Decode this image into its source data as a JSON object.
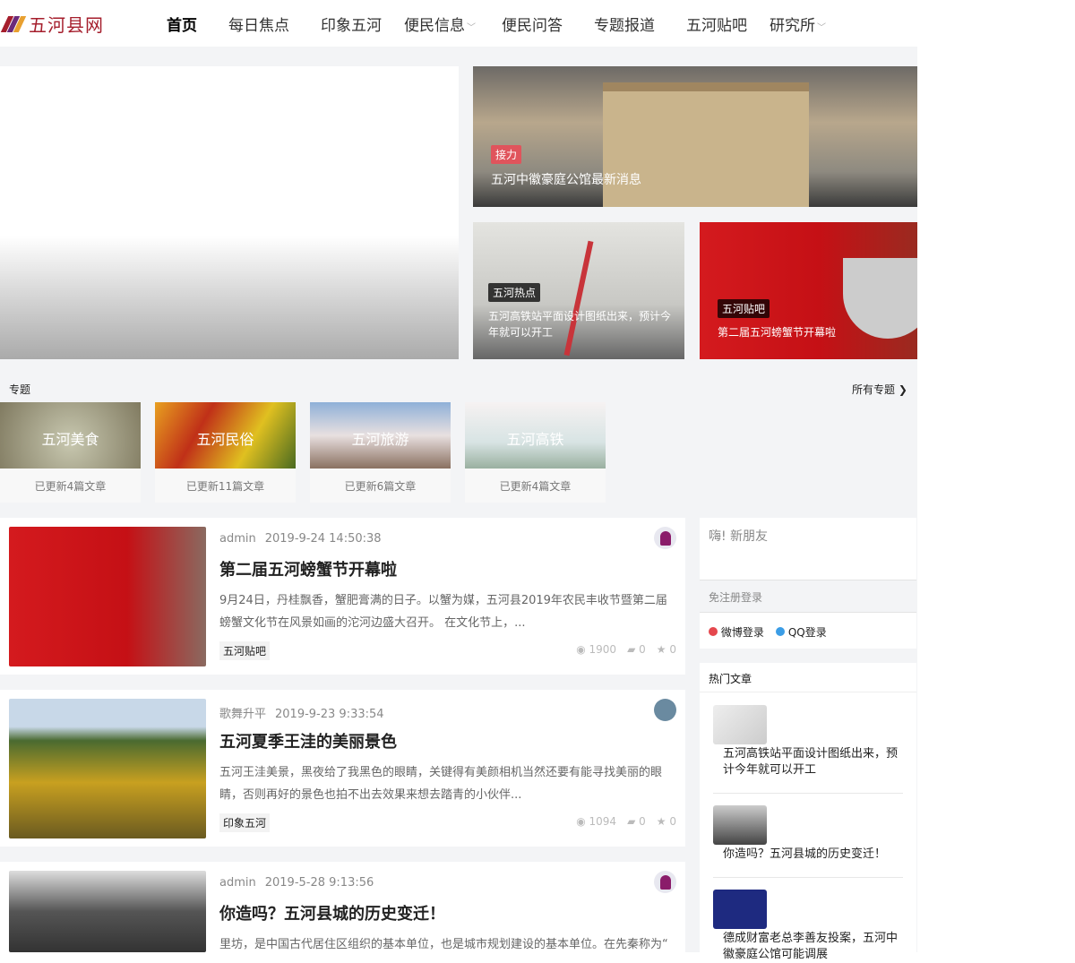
{
  "site": {
    "logo_text": "五河县网"
  },
  "nav": {
    "items": [
      {
        "label": "首页",
        "active": true
      },
      {
        "label": "每日焦点"
      },
      {
        "label": "印象五河"
      },
      {
        "label": "便民信息",
        "dropdown": true
      },
      {
        "label": "便民问答"
      },
      {
        "label": "专题报道"
      },
      {
        "label": "五河贴吧"
      },
      {
        "label": "研究所",
        "dropdown": true
      }
    ]
  },
  "hero": {
    "top": {
      "tag": "接力",
      "title": "五河中徽豪庭公馆最新消息"
    },
    "bottom_left": {
      "tag": "五河热点",
      "title": "五河高铁站平面设计图纸出来，预计今年就可以开工"
    },
    "bottom_right": {
      "tag": "五河贴吧",
      "title": "第二届五河螃蟹节开幕啦"
    }
  },
  "topics": {
    "heading": "专题",
    "all_label": "所有专题 ❯",
    "items": [
      {
        "name": "五河美食",
        "updated": "已更新4篇文章"
      },
      {
        "name": "五河民俗",
        "updated": "已更新11篇文章"
      },
      {
        "name": "五河旅游",
        "updated": "已更新6篇文章"
      },
      {
        "name": "五河高铁",
        "updated": "已更新4篇文章"
      }
    ]
  },
  "articles": [
    {
      "author": "admin",
      "date": "2019-9-24 14:50:38",
      "title": "第二届五河螃蟹节开幕啦",
      "excerpt": "9月24日，丹桂飘香，蟹肥膏满的日子。以蟹为媒，五河县2019年农民丰收节暨第二届螃蟹文化节在风景如画的沱河边盛大召开。 在文化节上，...",
      "category": "五河贴吧",
      "views": "1900",
      "comments": "0",
      "likes": "0"
    },
    {
      "author": "歌舞升平",
      "date": "2019-9-23 9:33:54",
      "title": "五河夏季王洼的美丽景色",
      "excerpt": "五河王洼美景，黑夜给了我黑色的眼睛，关键得有美颜相机当然还要有能寻找美丽的眼睛，否则再好的景色也拍不出去效果来想去踏青的小伙伴...",
      "category": "印象五河",
      "views": "1094",
      "comments": "0",
      "likes": "0"
    },
    {
      "author": "admin",
      "date": "2019-5-28 9:13:56",
      "title": "你造吗？五河县城的历史变迁！",
      "excerpt": "里坊，是中国古代居住区组织的基本单位，也是城市规划建设的基本单位。在先秦称为“"
    }
  ],
  "sidebar": {
    "greeting": "嗨! 新朋友",
    "login_heading": "免注册登录",
    "weibo_login": "微博登录",
    "qq_login": "QQ登录",
    "hot_heading": "热门文章",
    "hot": [
      "五河高铁站平面设计图纸出来，预计今年就可以开工",
      "你造吗？五河县城的历史变迁！",
      "德成财富老总李善友投案，五河中徽豪庭公馆可能调展"
    ]
  },
  "colors": {
    "brand": "#a51e2c",
    "weibo": "#e5474d",
    "qq": "#3b9de6"
  }
}
